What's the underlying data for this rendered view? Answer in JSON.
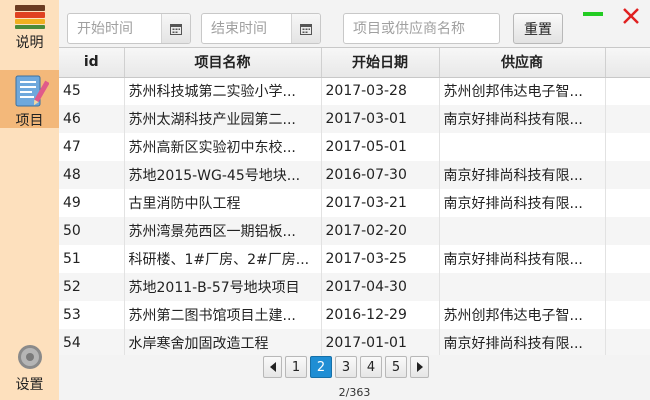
{
  "sidebar": {
    "items": [
      {
        "label": "说明",
        "icon": "notebook-icon"
      },
      {
        "label": "项目",
        "icon": "document-pencil-icon",
        "active": true
      },
      {
        "label": "设置",
        "icon": "gear-icon"
      }
    ]
  },
  "toolbar": {
    "start_placeholder": "开始时间",
    "end_placeholder": "结束时间",
    "search_placeholder": "项目或供应商名称",
    "reset_label": "重置"
  },
  "colors": {
    "sidebar_bg": "#fde0bd",
    "sidebar_active": "#f3b87a",
    "minimize": "#22cc22",
    "close": "#e02020",
    "page_active": "#1f8ed4"
  },
  "table": {
    "headers": [
      "id",
      "项目名称",
      "开始日期",
      "供应商"
    ],
    "rows": [
      {
        "id": "45",
        "name": "苏州科技城第二实验小学...",
        "date": "2017-03-28",
        "supplier": "苏州创邦伟达电子智..."
      },
      {
        "id": "46",
        "name": "苏州太湖科技产业园第二...",
        "date": "2017-03-01",
        "supplier": "南京好排尚科技有限..."
      },
      {
        "id": "47",
        "name": "苏州高新区实验初中东校...",
        "date": "2017-05-01",
        "supplier": ""
      },
      {
        "id": "48",
        "name": "苏地2015-WG-45号地块...",
        "date": "2016-07-30",
        "supplier": "南京好排尚科技有限..."
      },
      {
        "id": "49",
        "name": "古里消防中队工程",
        "date": "2017-03-21",
        "supplier": "南京好排尚科技有限..."
      },
      {
        "id": "50",
        "name": "苏州湾景苑西区一期铝板...",
        "date": "2017-02-20",
        "supplier": ""
      },
      {
        "id": "51",
        "name": "科研楼、1#厂房、2#厂房...",
        "date": "2017-03-25",
        "supplier": "南京好排尚科技有限..."
      },
      {
        "id": "52",
        "name": "苏地2011-B-57号地块项目",
        "date": "2017-04-30",
        "supplier": ""
      },
      {
        "id": "53",
        "name": "苏州第二图书馆项目土建...",
        "date": "2016-12-29",
        "supplier": "苏州创邦伟达电子智..."
      },
      {
        "id": "54",
        "name": "水岸寒舍加固改造工程",
        "date": "2017-01-01",
        "supplier": "南京好排尚科技有限..."
      }
    ]
  },
  "pagination": {
    "pages": [
      "1",
      "2",
      "3",
      "4",
      "5"
    ],
    "current": "2",
    "info": "2/363"
  }
}
